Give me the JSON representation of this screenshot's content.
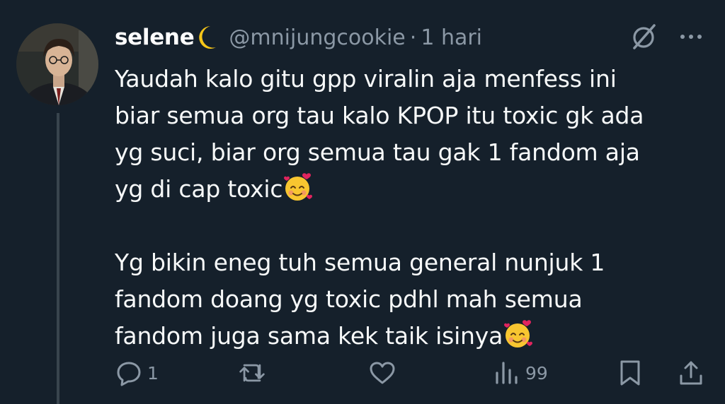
{
  "author": {
    "name": "selene",
    "name_emoji": "crescent-moon",
    "handle": "@mnijungcookie",
    "separator": "·",
    "time": "1 hari"
  },
  "tweet": {
    "lines": [
      "Yaudah kalo gitu gpp viralin aja menfess ini",
      "biar semua org tau kalo KPOP itu toxic gk ada",
      "yg suci, biar org semua tau gak 1 fandom aja",
      "yg di cap toxic",
      "Yg bikin eneg tuh semua general nunjuk 1",
      "fandom doang yg toxic pdhl mah semua",
      "fandom juga sama kek taik isinya"
    ],
    "emoji": "smiling-face-with-hearts"
  },
  "actions": {
    "replies": "1",
    "retweets": "",
    "likes": "",
    "views": "99"
  },
  "colors": {
    "background": "#15202b",
    "text": "#f7f9f9",
    "muted": "#8b98a5",
    "thread_line": "#38444d"
  }
}
